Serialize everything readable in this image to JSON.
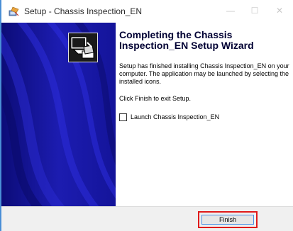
{
  "window": {
    "title": "Setup - Chassis Inspection_EN"
  },
  "titlebar": {
    "minimize_glyph": "—",
    "maximize_glyph": "☐",
    "close_glyph": "✕"
  },
  "sidebar": {
    "icon": "computer-install-icon"
  },
  "content": {
    "heading": "Completing the Chassis Inspection_EN Setup Wizard",
    "paragraph1": "Setup has finished installing Chassis Inspection_EN on your computer. The application may be launched by selecting the installed icons.",
    "paragraph2": "Click Finish to exit Setup.",
    "launch_checkbox_label": "Launch Chassis Inspection_EN",
    "launch_checked": false
  },
  "footer": {
    "finish_label": "Finish"
  },
  "colors": {
    "sidebar_blue": "#18189b",
    "highlight_red": "#e01a1a",
    "heading_color": "#000033"
  }
}
